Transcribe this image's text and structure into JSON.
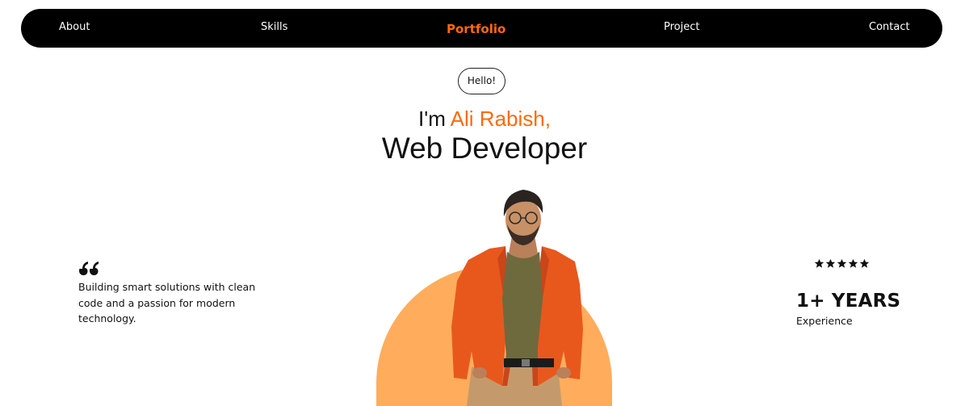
{
  "nav": {
    "about": "About",
    "skills": "Skills",
    "brand": "Portfolio",
    "project": "Project",
    "contact": "Contact"
  },
  "hero": {
    "greeting": "Hello!",
    "intro_prefix": "I'm ",
    "name": "Ali Rabish,",
    "role": "Web Developer"
  },
  "quote": {
    "icon": "quote-icon",
    "text": "Building smart solutions with clean code and a passion for modern technology."
  },
  "stats": {
    "rating_stars": 5,
    "years": "1+ YEARS",
    "label": "Experience"
  },
  "colors": {
    "accent": "#ff6a0a",
    "arch": "#ffad5c",
    "nav_bg": "#000000"
  }
}
